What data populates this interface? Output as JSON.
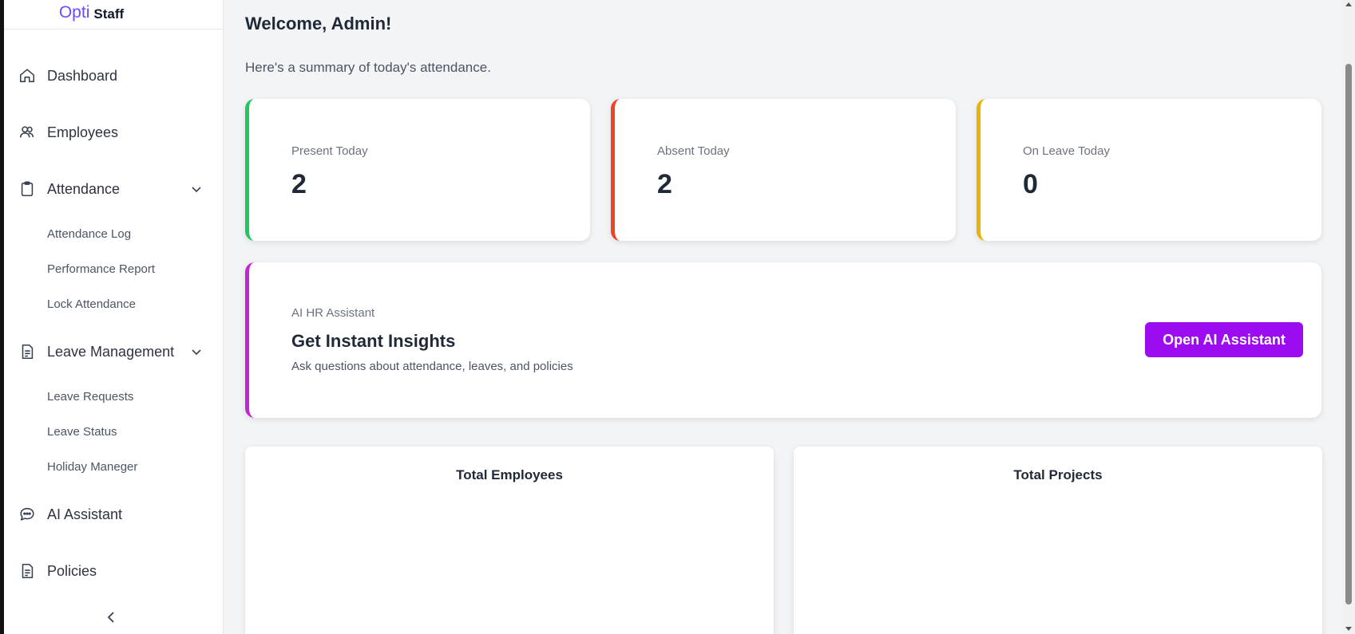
{
  "brand": {
    "part1": "Opti",
    "part2": "Staff"
  },
  "sidebar": {
    "items": [
      {
        "label": "Dashboard",
        "icon": "home-icon"
      },
      {
        "label": "Employees",
        "icon": "users-icon"
      },
      {
        "label": "Attendance",
        "icon": "clipboard-icon",
        "expanded": true
      },
      {
        "label": "Leave Management",
        "icon": "document-icon",
        "expanded": true
      },
      {
        "label": "AI Assistant",
        "icon": "chat-icon"
      },
      {
        "label": "Policies",
        "icon": "document-icon"
      }
    ],
    "attendance_sub": [
      "Attendance Log",
      "Performance Report",
      "Lock Attendance"
    ],
    "leave_sub": [
      "Leave Requests",
      "Leave Status",
      "Holiday Maneger"
    ]
  },
  "main": {
    "welcome": "Welcome, Admin!",
    "summary": "Here's a summary of today's attendance."
  },
  "stats": [
    {
      "title": "Present Today",
      "value": "2",
      "color": "#22c55e"
    },
    {
      "title": "Absent Today",
      "value": "2",
      "color": "#ef4422"
    },
    {
      "title": "On Leave Today",
      "value": "0",
      "color": "#eab308"
    }
  ],
  "ai_card": {
    "kicker": "AI HR Assistant",
    "heading": "Get Instant Insights",
    "subtext": "Ask questions about attendance, leaves, and policies",
    "button": "Open AI Assistant",
    "accent": "#c026d3",
    "button_color": "#9b0df0"
  },
  "panels": [
    {
      "title": "Total Employees"
    },
    {
      "title": "Total Projects"
    }
  ]
}
